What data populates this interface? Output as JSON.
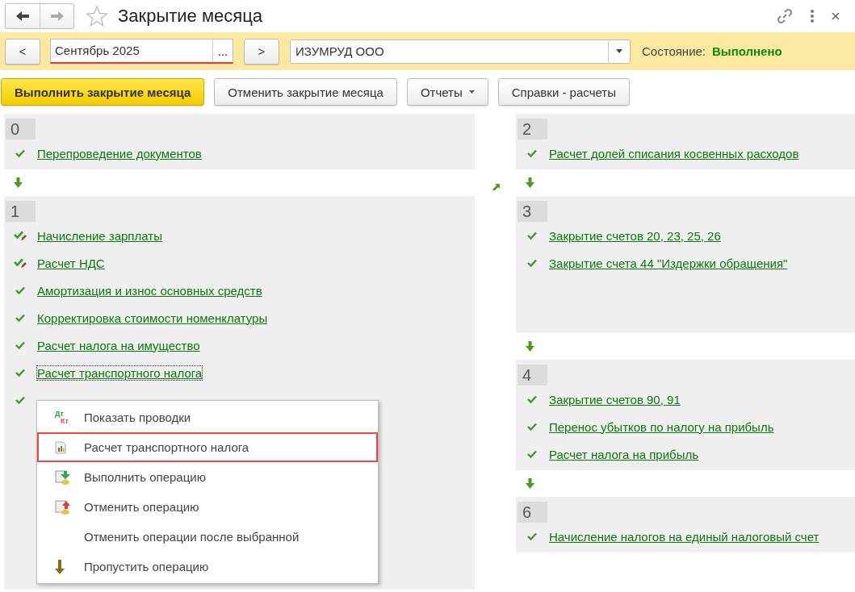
{
  "window": {
    "title": "Закрытие месяца",
    "favorite": false
  },
  "period_bar": {
    "prev": "<",
    "period": "Сентябрь 2025",
    "choose": "...",
    "next": ">",
    "organization": "ИЗУМРУД ООО",
    "state_label": "Состояние:",
    "state_value": "Выполнено"
  },
  "toolbar": [
    {
      "label": "Выполнить закрытие месяца",
      "kind": "primary"
    },
    {
      "label": "Отменить закрытие месяца",
      "kind": "plain"
    },
    {
      "label": "Отчеты",
      "kind": "dropdown"
    },
    {
      "label": "Справки - расчеты",
      "kind": "plain"
    }
  ],
  "left_steps": [
    {
      "number": "0",
      "items": [
        {
          "label": "Перепроведение документов",
          "kind": "done",
          "focused": false
        }
      ]
    },
    {
      "number": "1",
      "items": [
        {
          "label": "Начисление зарплаты",
          "kind": "done_edited",
          "focused": false
        },
        {
          "label": "Расчет НДС",
          "kind": "done_edited",
          "focused": false
        },
        {
          "label": "Амортизация и износ основных средств",
          "kind": "done",
          "focused": false
        },
        {
          "label": "Корректировка стоимости номенклатуры",
          "kind": "done",
          "focused": false
        },
        {
          "label": "Расчет налога на имущество",
          "kind": "done",
          "focused": false
        },
        {
          "label": "Расчет транспортного налога",
          "kind": "done",
          "focused": true
        },
        {
          "kind": "done"
        }
      ]
    }
  ],
  "right_steps": [
    {
      "number": "2",
      "items": [
        {
          "label": "Расчет долей списания косвенных расходов",
          "kind": "done",
          "focused": false
        }
      ]
    },
    {
      "number": "3",
      "items": [
        {
          "label": "Закрытие счетов 20, 23, 25, 26",
          "kind": "done",
          "focused": false
        },
        {
          "label": "Закрытие счета 44 \"Издержки обращения\"",
          "kind": "done",
          "focused": false
        }
      ]
    },
    {
      "number": "4",
      "items": [
        {
          "label": "Закрытие счетов 90, 91",
          "kind": "done",
          "focused": false
        },
        {
          "label": "Перенос убытков по налогу на прибыль",
          "kind": "done",
          "focused": false
        },
        {
          "label": "Расчет налога на прибыль",
          "kind": "done",
          "focused": false
        }
      ]
    },
    {
      "number": "6",
      "items": [
        {
          "label": "Начисление налогов на единый налоговый счет",
          "kind": "done",
          "focused": false
        }
      ]
    }
  ],
  "context_menu": [
    {
      "label": "Показать проводки",
      "kind": "postings",
      "icon_text": [
        "Дт",
        "Кт"
      ],
      "highlighted": false
    },
    {
      "label": "Расчет транспортного налога",
      "kind": "report",
      "highlighted": true
    },
    {
      "label": "Выполнить операцию",
      "kind": "execute",
      "highlighted": false
    },
    {
      "label": "Отменить операцию",
      "kind": "cancel",
      "highlighted": false
    },
    {
      "label": "Отменить операции после выбранной",
      "kind": "plain",
      "highlighted": false
    },
    {
      "label": "Пропустить операцию",
      "kind": "skip",
      "highlighted": false
    }
  ]
}
